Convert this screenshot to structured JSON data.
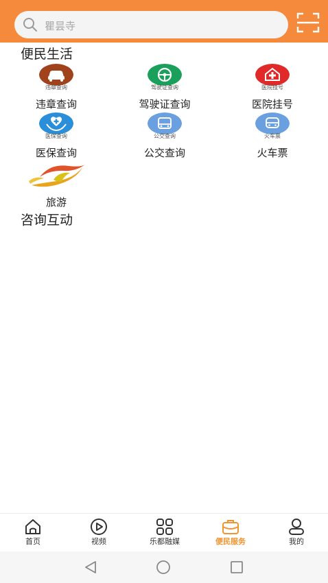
{
  "search": {
    "placeholder": "瞿昙寺"
  },
  "sections": {
    "life": "便民生活",
    "consult": "咨询互动"
  },
  "services": [
    {
      "name": "violation-query",
      "sub": "违章查询",
      "label": "违章查询",
      "color": "#a0421b"
    },
    {
      "name": "license-query",
      "sub": "驾驶证查询",
      "label": "驾驶证查询",
      "color": "#1aa05a"
    },
    {
      "name": "hospital-register",
      "sub": "医院挂号",
      "label": "医院挂号",
      "color": "#e02a2a"
    },
    {
      "name": "medical-insurance",
      "sub": "医保查询",
      "label": "医保查询",
      "color": "#2a8fd8"
    },
    {
      "name": "bus-query",
      "sub": "公交查询",
      "label": "公交查询",
      "color": "#6a9fe0"
    },
    {
      "name": "train-ticket",
      "sub": "火车票",
      "label": "火车票",
      "color": "#6a9fe0"
    },
    {
      "name": "travel",
      "sub": "",
      "label": "旅游",
      "color": "#e8a41c"
    }
  ],
  "tabs": [
    {
      "label": "首页"
    },
    {
      "label": "视频"
    },
    {
      "label": "乐都融媒"
    },
    {
      "label": "便民服务",
      "active": true
    },
    {
      "label": "我的"
    }
  ],
  "colors": {
    "accent": "#f58a3c",
    "active_tab": "#f0942f"
  }
}
